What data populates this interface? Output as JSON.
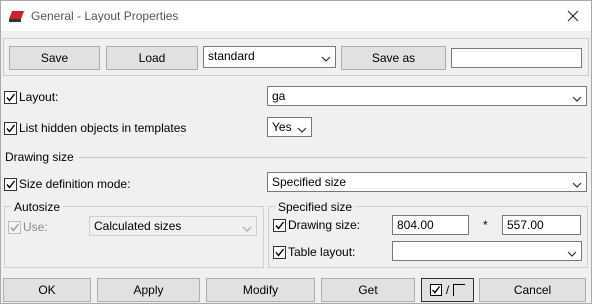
{
  "window": {
    "title": "General - Layout Properties"
  },
  "toolbar": {
    "save_label": "Save",
    "load_label": "Load",
    "preset_value": "standard",
    "save_as_label": "Save as",
    "save_as_name": ""
  },
  "layout": {
    "label": "Layout:",
    "value": "ga",
    "checked": true
  },
  "list_hidden": {
    "label": "List hidden objects in templates",
    "value": "Yes",
    "checked": true
  },
  "drawing_size": {
    "section_label": "Drawing size",
    "mode_label": "Size definition mode:",
    "mode_value": "Specified size",
    "mode_checked": true,
    "autosize": {
      "group_label": "Autosize",
      "use_label": "Use:",
      "use_value": "Calculated sizes"
    },
    "specified": {
      "group_label": "Specified size",
      "drawing_size_label": "Drawing size:",
      "width": "804.00",
      "separator": "*",
      "height": "557.00",
      "table_layout_label": "Table layout:",
      "table_layout_value": ""
    }
  },
  "footer": {
    "ok_label": "OK",
    "apply_label": "Apply",
    "modify_label": "Modify",
    "get_label": "Get",
    "toggle_separator": "/",
    "cancel_label": "Cancel"
  }
}
